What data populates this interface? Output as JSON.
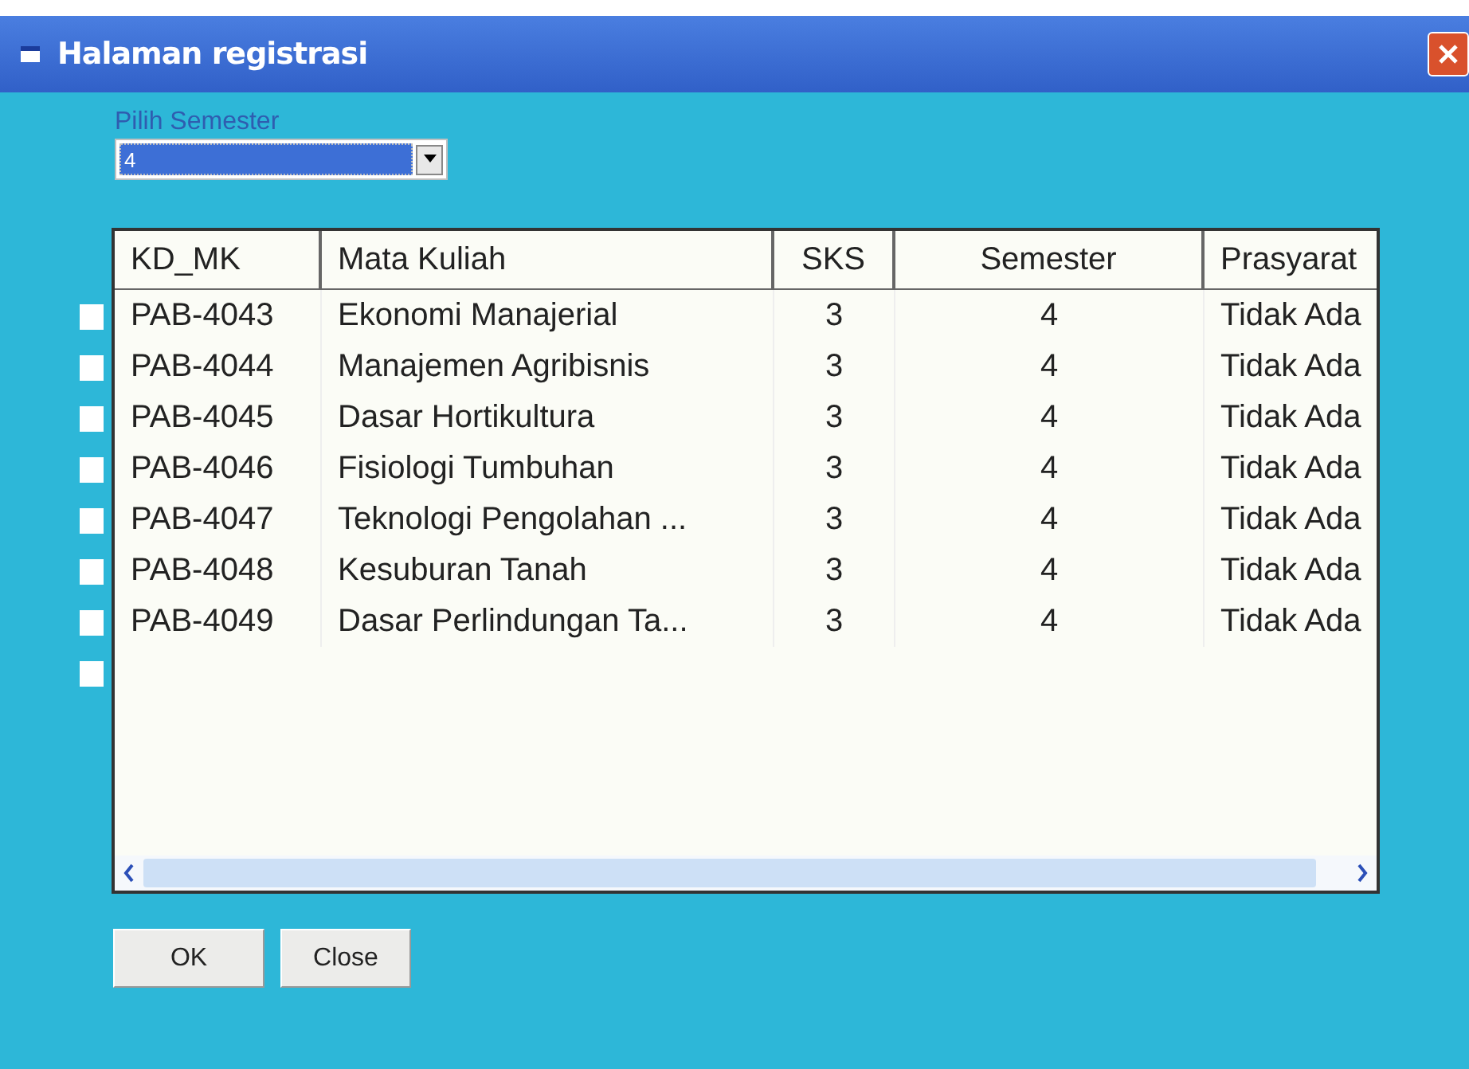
{
  "window": {
    "title": "Halaman registrasi"
  },
  "semester_picker": {
    "label": "Pilih Semester",
    "value": "4"
  },
  "checkboxes": [
    {
      "checked": false
    },
    {
      "checked": false
    },
    {
      "checked": false
    },
    {
      "checked": false
    },
    {
      "checked": false
    },
    {
      "checked": false
    },
    {
      "checked": false
    },
    {
      "checked": false
    }
  ],
  "table": {
    "columns": [
      "KD_MK",
      "Mata Kuliah",
      "SKS",
      "Semester",
      "Prasyarat"
    ],
    "rows": [
      [
        "PAB-4043",
        "Ekonomi Manajerial",
        "3",
        "4",
        "Tidak Ada"
      ],
      [
        "PAB-4044",
        "Manajemen Agribisnis",
        "3",
        "4",
        "Tidak Ada"
      ],
      [
        "PAB-4045",
        "Dasar Hortikultura",
        "3",
        "4",
        "Tidak Ada"
      ],
      [
        "PAB-4046",
        "Fisiologi Tumbuhan",
        "3",
        "4",
        "Tidak Ada"
      ],
      [
        "PAB-4047",
        "Teknologi Pengolahan ...",
        "3",
        "4",
        "Tidak Ada"
      ],
      [
        "PAB-4048",
        "Kesuburan Tanah",
        "3",
        "4",
        "Tidak Ada"
      ],
      [
        "PAB-4049",
        "Dasar Perlindungan Ta...",
        "3",
        "4",
        "Tidak Ada"
      ]
    ]
  },
  "buttons": [
    "OK",
    "Close"
  ]
}
